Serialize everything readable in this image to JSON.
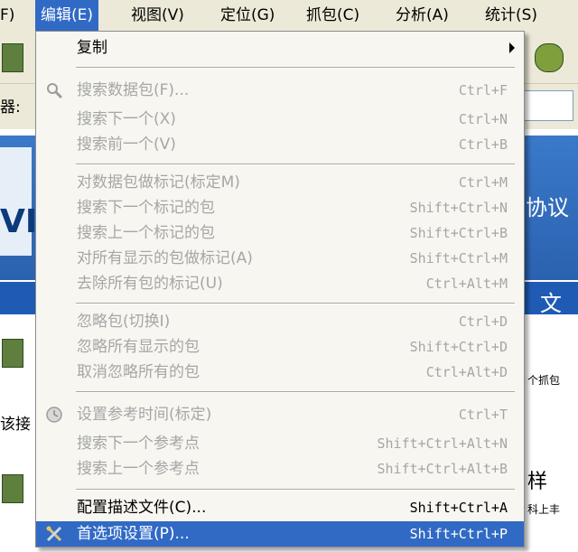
{
  "menubar": {
    "items": [
      "F)",
      "编辑(E)",
      "视图(V)",
      "定位(G)",
      "抓包(C)",
      "分析(A)",
      "统计(S)"
    ]
  },
  "background": {
    "filter_label_fragment": "器:",
    "banner_fragment": "VI",
    "right_fragment_1": "协议",
    "right_fragment_2": "文",
    "left_fragment": "该接",
    "right_fragment_3": "个抓包",
    "right_fragment_4": "样",
    "right_fragment_5": "科上丰"
  },
  "edit_menu": {
    "items": [
      {
        "label": "复制",
        "shortcut": "",
        "state": "enabled",
        "submenu": true
      },
      {
        "label": "搜索数据包(F)...",
        "shortcut": "Ctrl+F",
        "state": "disabled",
        "icon": "magnifier-icon"
      },
      {
        "label": "搜索下一个(X)",
        "shortcut": "Ctrl+N",
        "state": "disabled"
      },
      {
        "label": "搜索前一个(V)",
        "shortcut": "Ctrl+B",
        "state": "disabled"
      },
      {
        "label": "对数据包做标记(标定M)",
        "shortcut": "Ctrl+M",
        "state": "disabled"
      },
      {
        "label": "搜索下一个标记的包",
        "shortcut": "Shift+Ctrl+N",
        "state": "disabled"
      },
      {
        "label": "搜索上一个标记的包",
        "shortcut": "Shift+Ctrl+B",
        "state": "disabled"
      },
      {
        "label": "对所有显示的包做标记(A)",
        "shortcut": "Shift+Ctrl+M",
        "state": "disabled"
      },
      {
        "label": "去除所有包的标记(U)",
        "shortcut": "Ctrl+Alt+M",
        "state": "disabled"
      },
      {
        "label": "忽略包(切换I)",
        "shortcut": "Ctrl+D",
        "state": "disabled"
      },
      {
        "label": "忽略所有显示的包",
        "shortcut": "Shift+Ctrl+D",
        "state": "disabled"
      },
      {
        "label": "取消忽略所有的包",
        "shortcut": "Ctrl+Alt+D",
        "state": "disabled"
      },
      {
        "label": "设置参考时间(标定)",
        "shortcut": "Ctrl+T",
        "state": "disabled",
        "icon": "clock-icon"
      },
      {
        "label": "搜索下一个参考点",
        "shortcut": "Shift+Ctrl+Alt+N",
        "state": "disabled"
      },
      {
        "label": "搜索上一个参考点",
        "shortcut": "Shift+Ctrl+Alt+B",
        "state": "disabled"
      },
      {
        "label": "配置描述文件(C)...",
        "shortcut": "Shift+Ctrl+A",
        "state": "enabled"
      },
      {
        "label": "首选项设置(P)...",
        "shortcut": "Shift+Ctrl+P",
        "state": "highlight",
        "icon": "preferences-icon"
      }
    ]
  },
  "colors": {
    "menu_highlight": "#316ac5",
    "disabled_text": "#a6a6a6",
    "menu_bg": "#f7f6f1",
    "menubar_bg": "#ece9d8"
  }
}
